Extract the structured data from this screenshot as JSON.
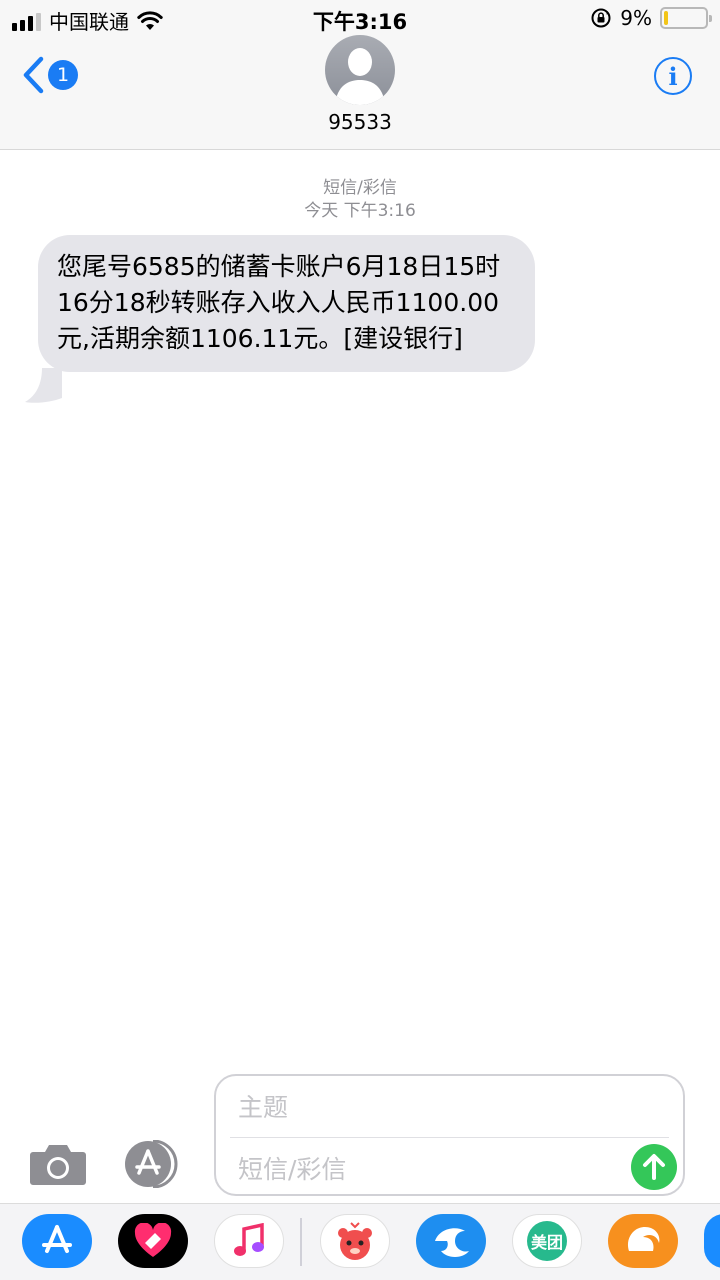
{
  "status_bar": {
    "carrier": "中国联通",
    "time": "下午3:16",
    "battery_percent": "9%",
    "battery_level": 0.09
  },
  "header": {
    "back_badge_count": "1",
    "contact_name": "95533",
    "info_label": "i"
  },
  "conversation": {
    "message_type": "短信/彩信",
    "timestamp": "今天 下午3:16",
    "messages": [
      {
        "direction": "incoming",
        "text": "您尾号6585的储蓄卡账户6月18日15时16分18秒转账存入收入人民币1100.00元,活期余额1106.11元。[建设银行]"
      }
    ]
  },
  "composer": {
    "subject_placeholder": "主题",
    "message_placeholder": "短信/彩信"
  },
  "app_drawer": {
    "apps": [
      {
        "name": "app-store-icon",
        "color": "#1a8cff"
      },
      {
        "name": "digital-touch-icon",
        "color": "#000000"
      },
      {
        "name": "music-icon",
        "color": "#ffffff"
      },
      {
        "name": "bear-sticker-icon",
        "color": "#ffffff"
      },
      {
        "name": "dolphin-app-icon",
        "color": "#1e8ef0"
      },
      {
        "name": "meituan-icon",
        "label": "美团",
        "color": "#27b98d"
      },
      {
        "name": "uc-browser-icon",
        "color": "#f7901e"
      }
    ]
  },
  "colors": {
    "accent_blue": "#1a7cf4",
    "bubble_gray": "#e5e5ea",
    "send_green": "#34c759",
    "battery_yellow": "#f3c518"
  }
}
